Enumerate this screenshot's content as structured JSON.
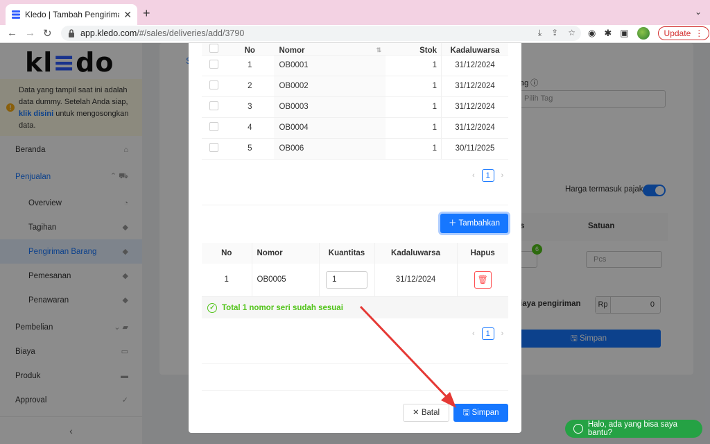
{
  "browser": {
    "tab_title": "Kledo | Tambah Pengiriman Ba",
    "url_host": "app.kledo.com",
    "url_path": "/#/sales/deliveries/add/3790",
    "update_label": "Update"
  },
  "sidebar": {
    "logo": "kledo",
    "dummy_text_1": "Data yang tampil saat ini adalah data dummy. Setelah Anda siap, ",
    "dummy_link": "klik disini",
    "dummy_text_2": " untuk mengosongkan data.",
    "items": [
      {
        "label": "Beranda"
      },
      {
        "label": "Penjualan"
      },
      {
        "label": "Overview"
      },
      {
        "label": "Tagihan"
      },
      {
        "label": "Pengiriman Barang"
      },
      {
        "label": "Pemesanan"
      },
      {
        "label": "Penawaran"
      },
      {
        "label": "Pembelian"
      },
      {
        "label": "Biaya"
      },
      {
        "label": "Produk"
      },
      {
        "label": "Approval"
      }
    ]
  },
  "background": {
    "tag_label": "ag",
    "tag_placeholder": "Pilih Tag",
    "harga_pajak": "Harga termasuk pajak",
    "col_s": "s",
    "col_satuan": "Satuan",
    "badge": "6",
    "pcs": "Pcs",
    "biaya_pengiriman": "iaya pengiriman",
    "rp": "Rp",
    "rp_value": "0",
    "simpan": "Simpan"
  },
  "modal": {
    "serial_table": {
      "headers": {
        "no": "No",
        "nomor": "Nomor",
        "stok": "Stok",
        "kadaluwarsa": "Kadaluwarsa"
      },
      "rows": [
        {
          "no": "1",
          "nomor": "OB0001",
          "stok": "1",
          "kadaluwarsa": "31/12/2024"
        },
        {
          "no": "2",
          "nomor": "OB0002",
          "stok": "1",
          "kadaluwarsa": "31/12/2024"
        },
        {
          "no": "3",
          "nomor": "OB0003",
          "stok": "1",
          "kadaluwarsa": "31/12/2024"
        },
        {
          "no": "4",
          "nomor": "OB0004",
          "stok": "1",
          "kadaluwarsa": "31/12/2024"
        },
        {
          "no": "5",
          "nomor": "OB006",
          "stok": "1",
          "kadaluwarsa": "30/11/2025"
        }
      ],
      "page": "1"
    },
    "tambahkan": "Tambahkan",
    "selected_table": {
      "headers": {
        "no": "No",
        "nomor": "Nomor",
        "kuantitas": "Kuantitas",
        "kadaluwarsa": "Kadaluwarsa",
        "hapus": "Hapus"
      },
      "rows": [
        {
          "no": "1",
          "nomor": "OB0005",
          "kuantitas": "1",
          "kadaluwarsa": "31/12/2024"
        }
      ],
      "page": "1"
    },
    "success_msg": "Total 1 nomor seri sudah sesuai",
    "batal": "Batal",
    "simpan": "Simpan"
  },
  "whatsapp": "Halo, ada yang bisa saya bantu?",
  "colors": {
    "primary": "#1677ff",
    "success": "#52c41a",
    "danger": "#ff4d4f",
    "annotation_arrow": "#e53935"
  }
}
